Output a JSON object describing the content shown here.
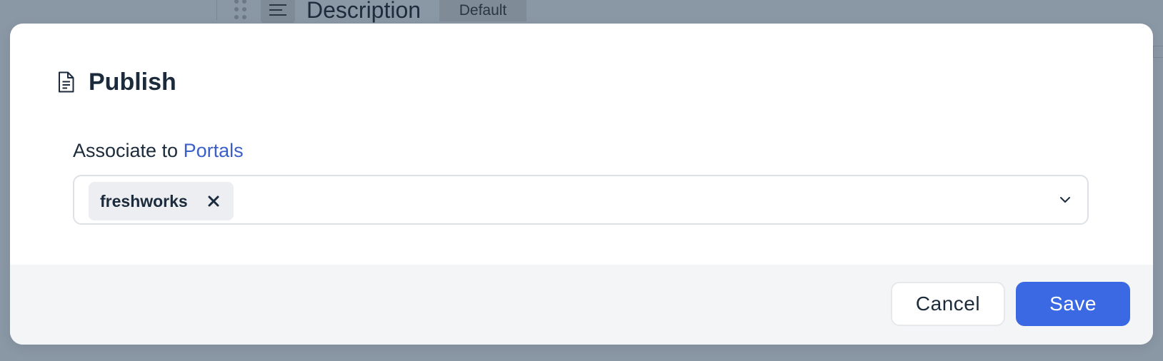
{
  "background": {
    "editor_field_title": "Description",
    "editor_field_tag": "Default"
  },
  "modal": {
    "title": "Publish",
    "icon": "document-icon",
    "field": {
      "label_prefix": "Associate to ",
      "label_link": "Portals",
      "selected_chips": [
        {
          "label": "freshworks"
        }
      ]
    },
    "footer": {
      "cancel_label": "Cancel",
      "save_label": "Save"
    }
  },
  "colors": {
    "primary": "#3b68e3",
    "link": "#3a5fc8",
    "text": "#1c2b3b",
    "overlay": "#8a97a5",
    "chip_bg": "#eceef2",
    "footer_bg": "#f4f5f7"
  }
}
